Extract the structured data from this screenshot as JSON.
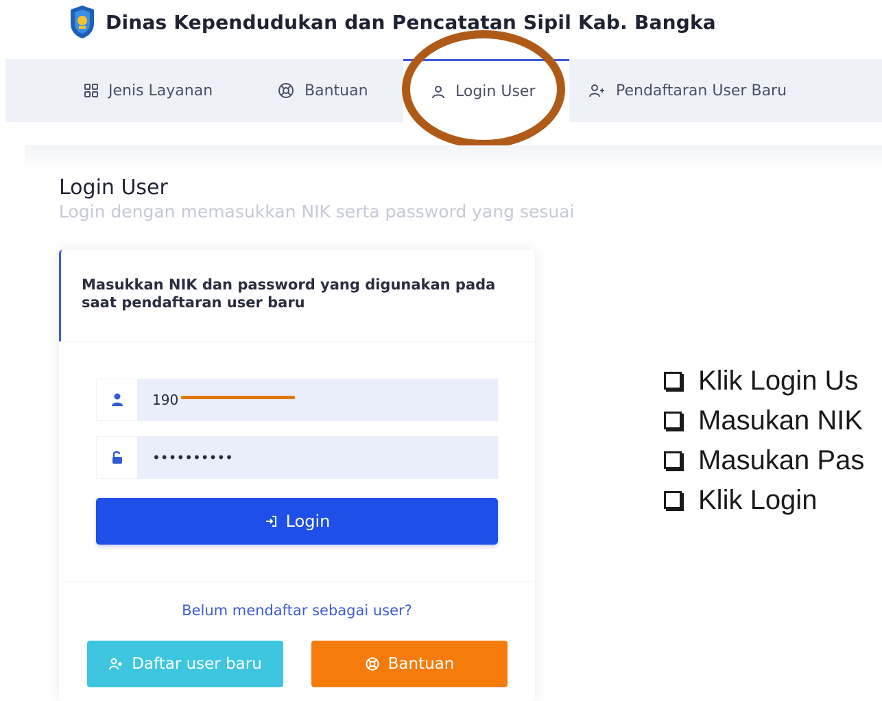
{
  "header": {
    "title": "Dinas Kependudukan dan Pencatatan Sipil Kab. Bangka",
    "logo_icon": "shield-emblem-icon"
  },
  "nav": {
    "items": [
      {
        "label": "Jenis Layanan",
        "icon": "grid-icon"
      },
      {
        "label": "Bantuan",
        "icon": "lifebuoy-icon"
      },
      {
        "label": "Login User",
        "icon": "user-icon",
        "active": true
      },
      {
        "label": "Pendaftaran User Baru",
        "icon": "user-plus-icon"
      }
    ]
  },
  "page": {
    "title": "Login User",
    "subtitle": "Login dengan memasukkan NIK serta password yang sesuai"
  },
  "form": {
    "instruction": "Masukkan NIK dan password yang digunakan pada saat pendaftaran user baru",
    "nik_value": "190",
    "password_value": "••••••••••",
    "login_label": "Login",
    "register_prompt": "Belum mendaftar sebagai user?",
    "register_label": "Daftar user baru",
    "help_label": "Bantuan"
  },
  "steps": [
    "Klik Login Us",
    "Masukan NIK",
    "Masukan Pas",
    "Klik Login"
  ],
  "colors": {
    "primary": "#1e4fe8",
    "accent_blue": "#3d5bd9",
    "info": "#3ec6e0",
    "warning": "#f57c0a",
    "highlight_ring": "#b05a17"
  }
}
